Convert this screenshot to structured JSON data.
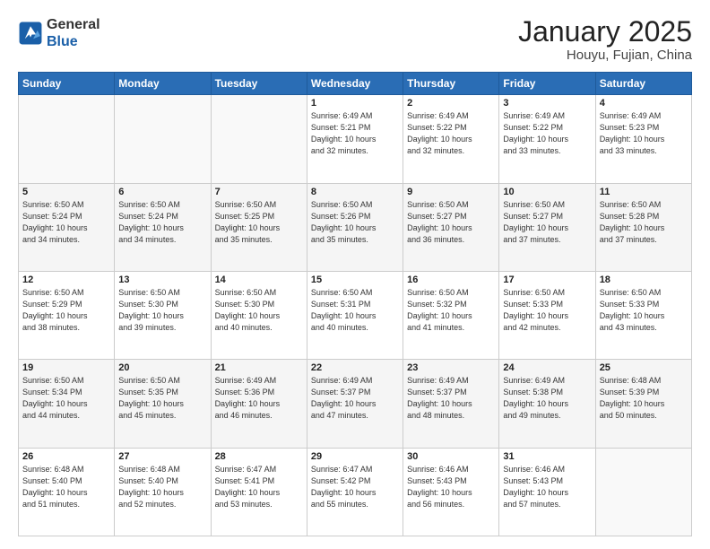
{
  "header": {
    "logo_line1": "General",
    "logo_line2": "Blue",
    "month_title": "January 2025",
    "location": "Houyu, Fujian, China"
  },
  "weekdays": [
    "Sunday",
    "Monday",
    "Tuesday",
    "Wednesday",
    "Thursday",
    "Friday",
    "Saturday"
  ],
  "weeks": [
    [
      {
        "day": "",
        "info": ""
      },
      {
        "day": "",
        "info": ""
      },
      {
        "day": "",
        "info": ""
      },
      {
        "day": "1",
        "info": "Sunrise: 6:49 AM\nSunset: 5:21 PM\nDaylight: 10 hours\nand 32 minutes."
      },
      {
        "day": "2",
        "info": "Sunrise: 6:49 AM\nSunset: 5:22 PM\nDaylight: 10 hours\nand 32 minutes."
      },
      {
        "day": "3",
        "info": "Sunrise: 6:49 AM\nSunset: 5:22 PM\nDaylight: 10 hours\nand 33 minutes."
      },
      {
        "day": "4",
        "info": "Sunrise: 6:49 AM\nSunset: 5:23 PM\nDaylight: 10 hours\nand 33 minutes."
      }
    ],
    [
      {
        "day": "5",
        "info": "Sunrise: 6:50 AM\nSunset: 5:24 PM\nDaylight: 10 hours\nand 34 minutes."
      },
      {
        "day": "6",
        "info": "Sunrise: 6:50 AM\nSunset: 5:24 PM\nDaylight: 10 hours\nand 34 minutes."
      },
      {
        "day": "7",
        "info": "Sunrise: 6:50 AM\nSunset: 5:25 PM\nDaylight: 10 hours\nand 35 minutes."
      },
      {
        "day": "8",
        "info": "Sunrise: 6:50 AM\nSunset: 5:26 PM\nDaylight: 10 hours\nand 35 minutes."
      },
      {
        "day": "9",
        "info": "Sunrise: 6:50 AM\nSunset: 5:27 PM\nDaylight: 10 hours\nand 36 minutes."
      },
      {
        "day": "10",
        "info": "Sunrise: 6:50 AM\nSunset: 5:27 PM\nDaylight: 10 hours\nand 37 minutes."
      },
      {
        "day": "11",
        "info": "Sunrise: 6:50 AM\nSunset: 5:28 PM\nDaylight: 10 hours\nand 37 minutes."
      }
    ],
    [
      {
        "day": "12",
        "info": "Sunrise: 6:50 AM\nSunset: 5:29 PM\nDaylight: 10 hours\nand 38 minutes."
      },
      {
        "day": "13",
        "info": "Sunrise: 6:50 AM\nSunset: 5:30 PM\nDaylight: 10 hours\nand 39 minutes."
      },
      {
        "day": "14",
        "info": "Sunrise: 6:50 AM\nSunset: 5:30 PM\nDaylight: 10 hours\nand 40 minutes."
      },
      {
        "day": "15",
        "info": "Sunrise: 6:50 AM\nSunset: 5:31 PM\nDaylight: 10 hours\nand 40 minutes."
      },
      {
        "day": "16",
        "info": "Sunrise: 6:50 AM\nSunset: 5:32 PM\nDaylight: 10 hours\nand 41 minutes."
      },
      {
        "day": "17",
        "info": "Sunrise: 6:50 AM\nSunset: 5:33 PM\nDaylight: 10 hours\nand 42 minutes."
      },
      {
        "day": "18",
        "info": "Sunrise: 6:50 AM\nSunset: 5:33 PM\nDaylight: 10 hours\nand 43 minutes."
      }
    ],
    [
      {
        "day": "19",
        "info": "Sunrise: 6:50 AM\nSunset: 5:34 PM\nDaylight: 10 hours\nand 44 minutes."
      },
      {
        "day": "20",
        "info": "Sunrise: 6:50 AM\nSunset: 5:35 PM\nDaylight: 10 hours\nand 45 minutes."
      },
      {
        "day": "21",
        "info": "Sunrise: 6:49 AM\nSunset: 5:36 PM\nDaylight: 10 hours\nand 46 minutes."
      },
      {
        "day": "22",
        "info": "Sunrise: 6:49 AM\nSunset: 5:37 PM\nDaylight: 10 hours\nand 47 minutes."
      },
      {
        "day": "23",
        "info": "Sunrise: 6:49 AM\nSunset: 5:37 PM\nDaylight: 10 hours\nand 48 minutes."
      },
      {
        "day": "24",
        "info": "Sunrise: 6:49 AM\nSunset: 5:38 PM\nDaylight: 10 hours\nand 49 minutes."
      },
      {
        "day": "25",
        "info": "Sunrise: 6:48 AM\nSunset: 5:39 PM\nDaylight: 10 hours\nand 50 minutes."
      }
    ],
    [
      {
        "day": "26",
        "info": "Sunrise: 6:48 AM\nSunset: 5:40 PM\nDaylight: 10 hours\nand 51 minutes."
      },
      {
        "day": "27",
        "info": "Sunrise: 6:48 AM\nSunset: 5:40 PM\nDaylight: 10 hours\nand 52 minutes."
      },
      {
        "day": "28",
        "info": "Sunrise: 6:47 AM\nSunset: 5:41 PM\nDaylight: 10 hours\nand 53 minutes."
      },
      {
        "day": "29",
        "info": "Sunrise: 6:47 AM\nSunset: 5:42 PM\nDaylight: 10 hours\nand 55 minutes."
      },
      {
        "day": "30",
        "info": "Sunrise: 6:46 AM\nSunset: 5:43 PM\nDaylight: 10 hours\nand 56 minutes."
      },
      {
        "day": "31",
        "info": "Sunrise: 6:46 AM\nSunset: 5:43 PM\nDaylight: 10 hours\nand 57 minutes."
      },
      {
        "day": "",
        "info": ""
      }
    ]
  ]
}
